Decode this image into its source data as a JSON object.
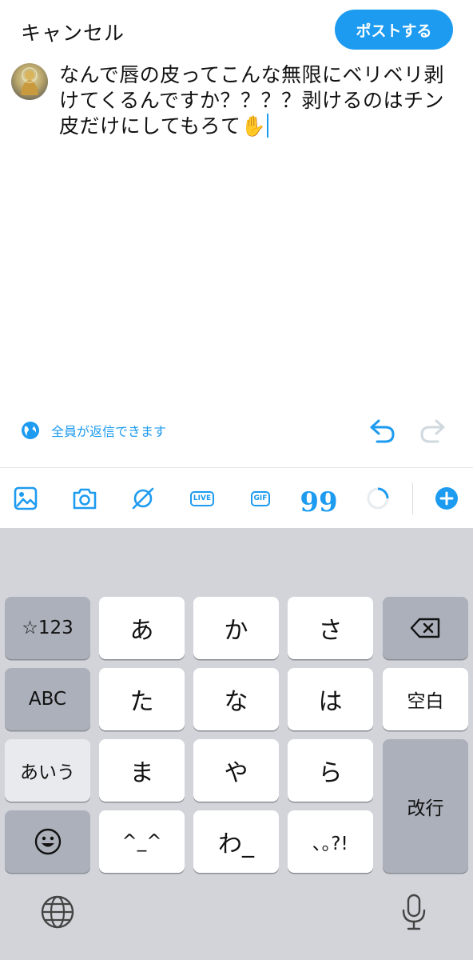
{
  "header": {
    "cancel_label": "キャンセル",
    "post_label": "ポストする"
  },
  "compose": {
    "text": "なんで唇の皮ってこんな無限にベリベリ剥けてくるんですか？？？？剥けるのはチン皮だけにしてもろて✋"
  },
  "reply_setting": {
    "label": "全員が返信できます",
    "icon": "globe-icon"
  },
  "toolbar": {
    "items": [
      "image-icon",
      "camera-icon",
      "grok-icon",
      "live-icon",
      "gif-icon",
      "quote-icon",
      "character-count-ring",
      "add-post-icon"
    ],
    "live_label": "LIVE",
    "gif_label": "GIF",
    "quote_glyph": "99"
  },
  "keyboard": {
    "row1": [
      "☆123",
      "あ",
      "か",
      "さ"
    ],
    "row2": [
      "ABC",
      "た",
      "な",
      "は",
      "空白"
    ],
    "row3": [
      "あいう",
      "ま",
      "や",
      "ら"
    ],
    "row4": [
      "☺",
      "^_^",
      "わ_",
      "､｡?!"
    ],
    "return_label": "改行",
    "backspace_icon": "delete-icon",
    "globe_icon": "globe-icon",
    "mic_icon": "microphone-icon"
  },
  "colors": {
    "accent": "#1d9bf0",
    "keyboard_bg": "#d2d4da",
    "key_dark": "#abb0ba",
    "key_light": "#ffffff"
  }
}
